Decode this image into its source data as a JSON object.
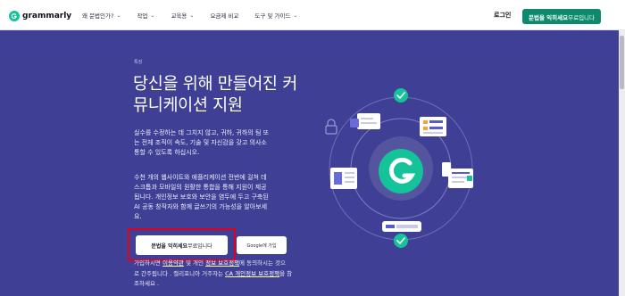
{
  "nav": {
    "brand": "grammarly",
    "menu": [
      {
        "label": "왜 문법인가?",
        "has_chevron": true
      },
      {
        "label": "작업",
        "has_chevron": true
      },
      {
        "label": "교육용",
        "has_chevron": true
      },
      {
        "label": "요금제 비교",
        "has_chevron": false
      },
      {
        "label": "도구 및 가이드",
        "has_chevron": true
      }
    ],
    "chevron": "⌄",
    "login": "로그인",
    "cta_bold": "문법을 익히세요",
    "cta_rest": "무료입니다"
  },
  "hero": {
    "eyebrow": "특징",
    "headline_line1": "당신을 위해 만들어진 커",
    "headline_line2": "뮤니케이션 지원",
    "p1_lines": [
      "실수를 수정하는 데 그치지 않고, 귀하, 귀하의 팀 또",
      "는 전체 조직이 속도, 기술 및 자신감을 갖고 의사소",
      "통할 수 있도록 하십시오."
    ],
    "p2_lines": [
      "수천 개의 웹사이트와 애플리케이션 전반에 걸쳐 데",
      "스크톱과 모바일의 원활한 통합을 통해 지원이 제공",
      "됩니다. 개인정보 보호와 보안을 염두에 두고 구축된",
      "AI 공동 창작자와 함께 글쓰기의 가능성을 알아보세",
      "요."
    ],
    "btn_primary_bold": "문법을 익히세요",
    "btn_primary_rest": "무료입니다",
    "btn_google": "Google에 가입",
    "fine_1_pre": "가입하시면",
    "fine_1_link1": "이용약관",
    "fine_1_mid": "및",
    "fine_1_mid2": "개인",
    "fine_1_link2": "정보 보호정책",
    "fine_1_post": "에 동의하시는 것으",
    "fine_2_pre": "로 간주됩니다 . 캘리포니아 거주자는",
    "fine_2_link": "CA 개인정보 보호정책",
    "fine_2_post": "을 참",
    "fine_3": "조하세요 ."
  },
  "icons": {
    "brand_logo": "grammarly-g-icon",
    "center_logo": "grammarly-g-large-icon",
    "check_top": "check-circle-icon",
    "check_bottom": "check-circle-icon",
    "lock": "lock-icon",
    "docs": "document-card-icons"
  },
  "colors": {
    "background": "#3f3f95",
    "accent_green": "#15c39a",
    "cta_green": "#0d8a6b",
    "highlight_red": "#e4001b"
  }
}
